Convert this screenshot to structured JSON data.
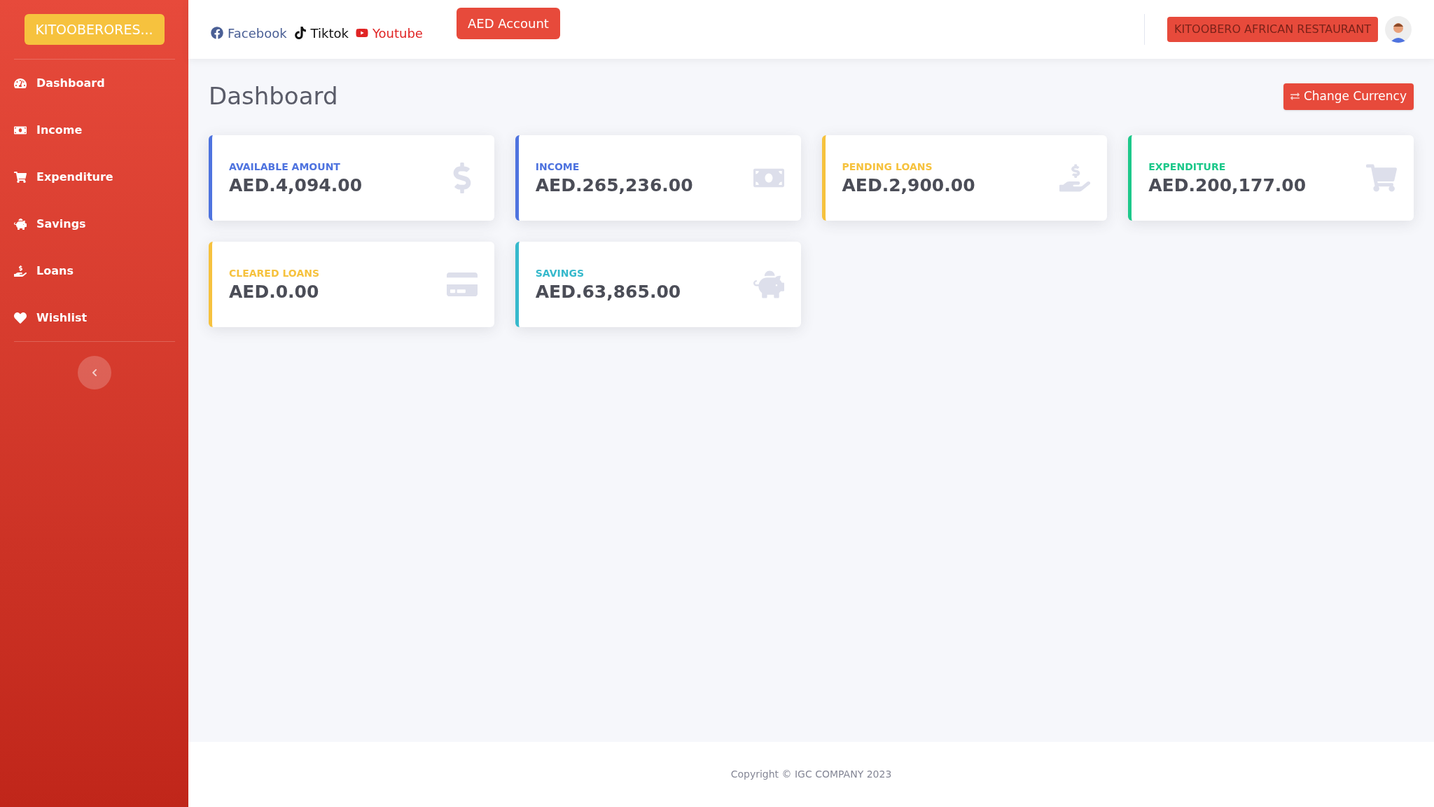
{
  "sidebar": {
    "brand": "KITOOBERORES...",
    "items": [
      {
        "label": "Dashboard"
      },
      {
        "label": "Income"
      },
      {
        "label": "Expenditure"
      },
      {
        "label": "Savings"
      },
      {
        "label": "Loans"
      },
      {
        "label": "Wishlist"
      }
    ]
  },
  "topbar": {
    "social_links": [
      {
        "label": "Facebook",
        "color": "#4a5f95"
      },
      {
        "label": "Tiktok",
        "color": "#111111"
      },
      {
        "label": "Youtube",
        "color": "#e02424"
      }
    ],
    "account_button": "AED Account",
    "user_badge": "KITOOBERO AFRICAN RESTAURANT"
  },
  "page": {
    "title": "Dashboard",
    "change_currency_button": "Change Currency"
  },
  "cards": [
    {
      "label": "AVAILABLE AMOUNT",
      "value": "AED.4,094.00",
      "color": "#4e73df"
    },
    {
      "label": "INCOME",
      "value": "AED.265,236.00",
      "color": "#4e73df"
    },
    {
      "label": "PENDING LOANS",
      "value": "AED.2,900.00",
      "color": "#f6c23e"
    },
    {
      "label": "EXPENDITURE",
      "value": "AED.200,177.00",
      "color": "#1cc88a"
    },
    {
      "label": "CLEARED LOANS",
      "value": "AED.0.00",
      "color": "#f6c23e"
    },
    {
      "label": "SAVINGS",
      "value": "AED.63,865.00",
      "color": "#36b9cc"
    }
  ],
  "footer": {
    "copyright": "Copyright © IGC COMPANY 2023"
  }
}
